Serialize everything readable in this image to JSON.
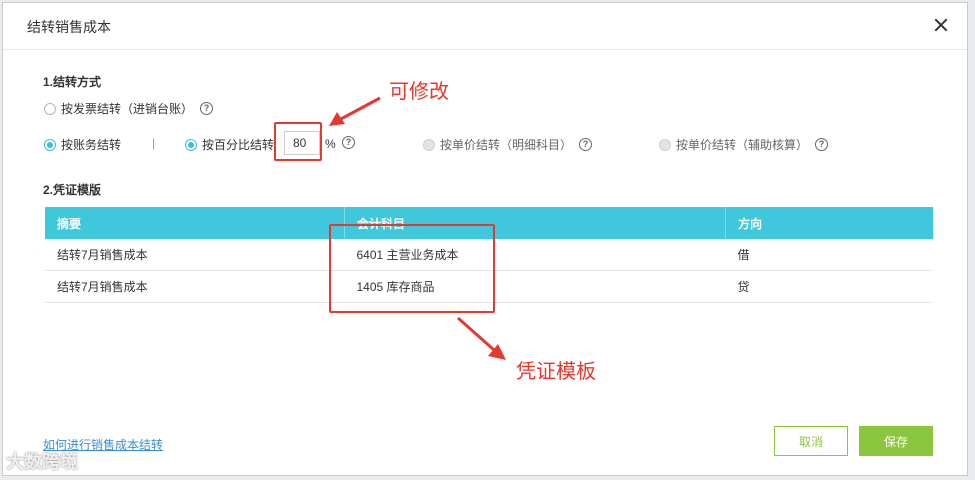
{
  "dialog": {
    "title": "结转销售成本"
  },
  "method_section": {
    "title": "1.结转方式",
    "opt_invoice": "按发票结转（进销台账）",
    "opt_ledger": "按账务结转",
    "separator": "|",
    "opt_percent": "按百分比结转",
    "percent_value": "80",
    "percent_sign": "%",
    "opt_unit_detail": "按单价结转（明细科目）",
    "opt_unit_aux": "按单价结转（辅助核算）",
    "help_glyph": "?"
  },
  "voucher_section": {
    "title": "2.凭证模版",
    "columns": [
      "摘要",
      "会计科目",
      "方向"
    ],
    "rows": [
      {
        "summary": "结转7月销售成本",
        "account": "6401 主营业务成本",
        "direction": "借"
      },
      {
        "summary": "结转7月销售成本",
        "account": "1405 库存商品",
        "direction": "贷"
      }
    ]
  },
  "annotations": {
    "editable": "可修改",
    "template": "凭证模板"
  },
  "footer": {
    "help_link": "如何进行销售成本结转",
    "cancel": "取消",
    "save": "保存"
  },
  "watermark": "大数跨境",
  "colors": {
    "accent": "#3fc7dc",
    "green": "#8cc63f",
    "annotation_red": "#e4392e",
    "link": "#3a8ed8"
  }
}
